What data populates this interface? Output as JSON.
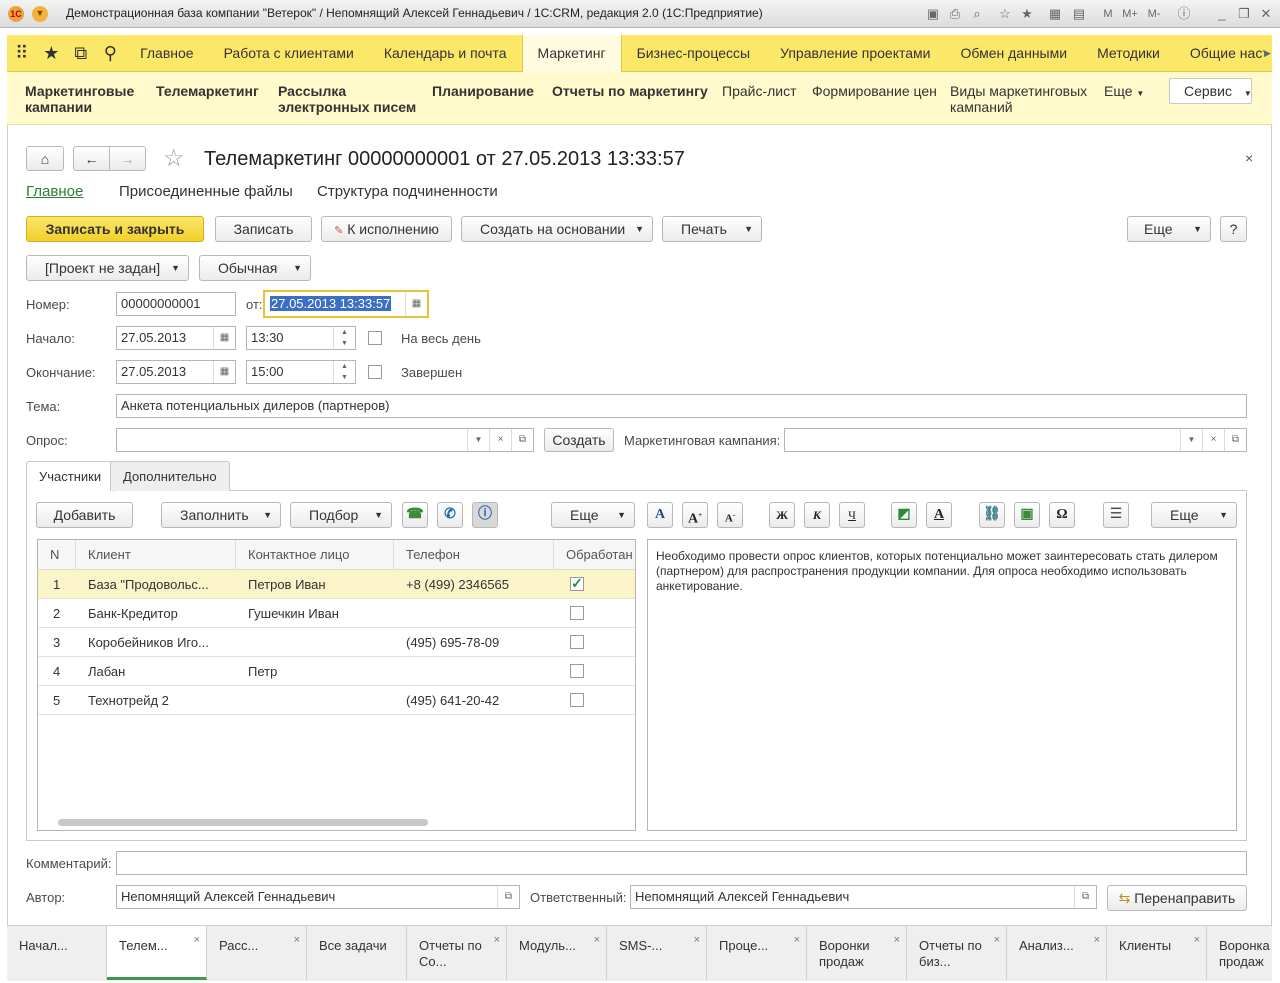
{
  "window": {
    "title": "Демонстрационная база компании \"Ветерок\" / Непомнящий Алексей Геннадьевич / 1С:CRM, редакция 2.0  (1С:Предприятие)"
  },
  "sections": [
    "Главное",
    "Работа с клиентами",
    "Календарь и почта",
    "Маркетинг",
    "Бизнес-процессы",
    "Управление проектами",
    "Обмен данными",
    "Методики",
    "Общие настро"
  ],
  "nav": {
    "items": [
      "Маркетинговые кампании",
      "Телемаркетинг",
      "Рассылка электронных писем",
      "Планирование",
      "Отчеты по маркетингу",
      "Прайс-лист",
      "Формирование цен",
      "Виды маркетинговых кампаний",
      "Еще"
    ],
    "service": "Сервис"
  },
  "doc": {
    "title": "Телемаркетинг 00000000001 от 27.05.2013 13:33:57",
    "subtabs": [
      "Главное",
      "Присоединенные файлы",
      "Структура подчиненности"
    ],
    "toolbar": {
      "save_close": "Записать и закрыть",
      "save": "Записать",
      "execute": "К исполнению",
      "create_based": "Создать на основании",
      "print": "Печать",
      "more": "Еще",
      "help": "?"
    },
    "project": "[Проект не задан]",
    "priority": "Обычная",
    "number_label": "Номер:",
    "number": "00000000001",
    "from_label": "от:",
    "from": "27.05.2013 13:33:57",
    "start_label": "Начало:",
    "start_date": "27.05.2013",
    "start_time": "13:30",
    "allday": "На весь день",
    "end_label": "Окончание:",
    "end_date": "27.05.2013",
    "end_time": "15:00",
    "done": "Завершен",
    "topic_label": "Тема:",
    "topic": "Анкета потенциальных дилеров (партнеров)",
    "poll_label": "Опрос:",
    "poll": "",
    "create": "Создать",
    "campaign_label": "Маркетинговая кампания:",
    "campaign": "",
    "tabs": [
      "Участники",
      "Дополнительно"
    ],
    "grid_buttons": {
      "add": "Добавить",
      "fill": "Заполнить",
      "pick": "Подбор",
      "more": "Еще",
      "more2": "Еще"
    },
    "columns": [
      "N",
      "Клиент",
      "Контактное лицо",
      "Телефон",
      "Обработан"
    ],
    "rows": [
      {
        "n": "1",
        "client": "База \"Продовольс...",
        "contact": "Петров Иван",
        "phone": "+8 (499) 2346565",
        "done": true
      },
      {
        "n": "2",
        "client": "Банк-Кредитор",
        "contact": "Гушечкин Иван",
        "phone": "",
        "done": false
      },
      {
        "n": "3",
        "client": "Коробейников Иго...",
        "contact": "",
        "phone": "(495) 695-78-09",
        "done": false
      },
      {
        "n": "4",
        "client": "Лабан",
        "contact": "Петр",
        "phone": "",
        "done": false
      },
      {
        "n": "5",
        "client": "Технотрейд 2",
        "contact": "",
        "phone": "(495) 641-20-42",
        "done": false
      }
    ],
    "notes": "Необходимо провести опрос клиентов, которых потенциально может заинтересовать стать дилером (партнером) для распространения продукции компании. Для опроса необходимо использовать анкетирование.",
    "comment_label": "Комментарий:",
    "comment": "",
    "author_label": "Автор:",
    "author": "Непомнящий Алексей Геннадьевич",
    "resp_label": "Ответственный:",
    "resp": "Непомнящий Алексей Геннадьевич",
    "redirect": "Перенаправить"
  },
  "bottom_tabs": [
    "Начал...",
    "Телем...",
    "Расс...",
    "Все задачи",
    "Отчеты по Со...",
    "Модуль...",
    "SMS-...",
    "Проце...",
    "Воронки продаж",
    "Отчеты по биз...",
    "Анализ...",
    "Клиенты",
    "Воронка продаж"
  ],
  "colors": {
    "accent": "#fbe869",
    "nav": "#fff9cc",
    "active_tab": "#3a9a4a",
    "selection": "#3b6fc4"
  }
}
